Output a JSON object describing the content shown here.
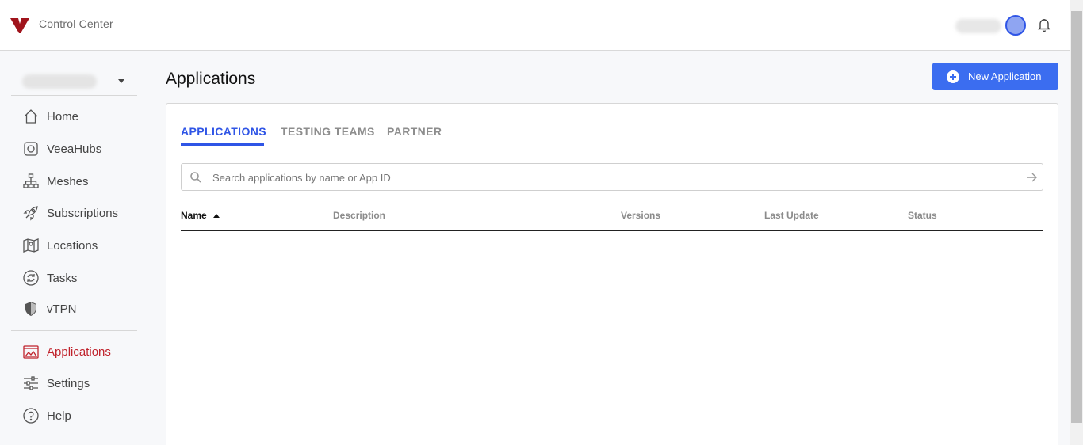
{
  "header": {
    "app_title": "Control Center",
    "icons": [
      "logo-icon",
      "bell-icon"
    ],
    "brand_color": "#a0141c"
  },
  "sidebar": {
    "items": [
      {
        "label": "Home",
        "icon": "home-icon",
        "active": false
      },
      {
        "label": "VeeaHubs",
        "icon": "veeahub-icon",
        "active": false
      },
      {
        "label": "Meshes",
        "icon": "mesh-icon",
        "active": false
      },
      {
        "label": "Subscriptions",
        "icon": "rocket-icon",
        "active": false
      },
      {
        "label": "Locations",
        "icon": "map-pin-icon",
        "active": false
      },
      {
        "label": "Tasks",
        "icon": "refresh-icon",
        "active": false
      },
      {
        "label": "vTPN",
        "icon": "shield-icon",
        "active": false
      },
      {
        "label": "Applications",
        "icon": "applications-icon",
        "active": true
      },
      {
        "label": "Settings",
        "icon": "sliders-icon",
        "active": false
      },
      {
        "label": "Help",
        "icon": "help-icon",
        "active": false
      }
    ],
    "active_color": "#c0232c"
  },
  "main": {
    "title": "Applications",
    "new_button_label": "New Application",
    "accent_color": "#3b6df0",
    "tabs": [
      {
        "label": "APPLICATIONS",
        "active": true
      },
      {
        "label": "TESTING TEAMS",
        "active": false
      },
      {
        "label": "PARTNER",
        "active": false
      }
    ],
    "search": {
      "placeholder": "Search applications by name or App ID",
      "value": ""
    },
    "table": {
      "columns": [
        "Name",
        "Description",
        "Versions",
        "Last Update",
        "Status"
      ],
      "sort": {
        "column": "Name",
        "direction": "ascending"
      },
      "rows": []
    }
  }
}
